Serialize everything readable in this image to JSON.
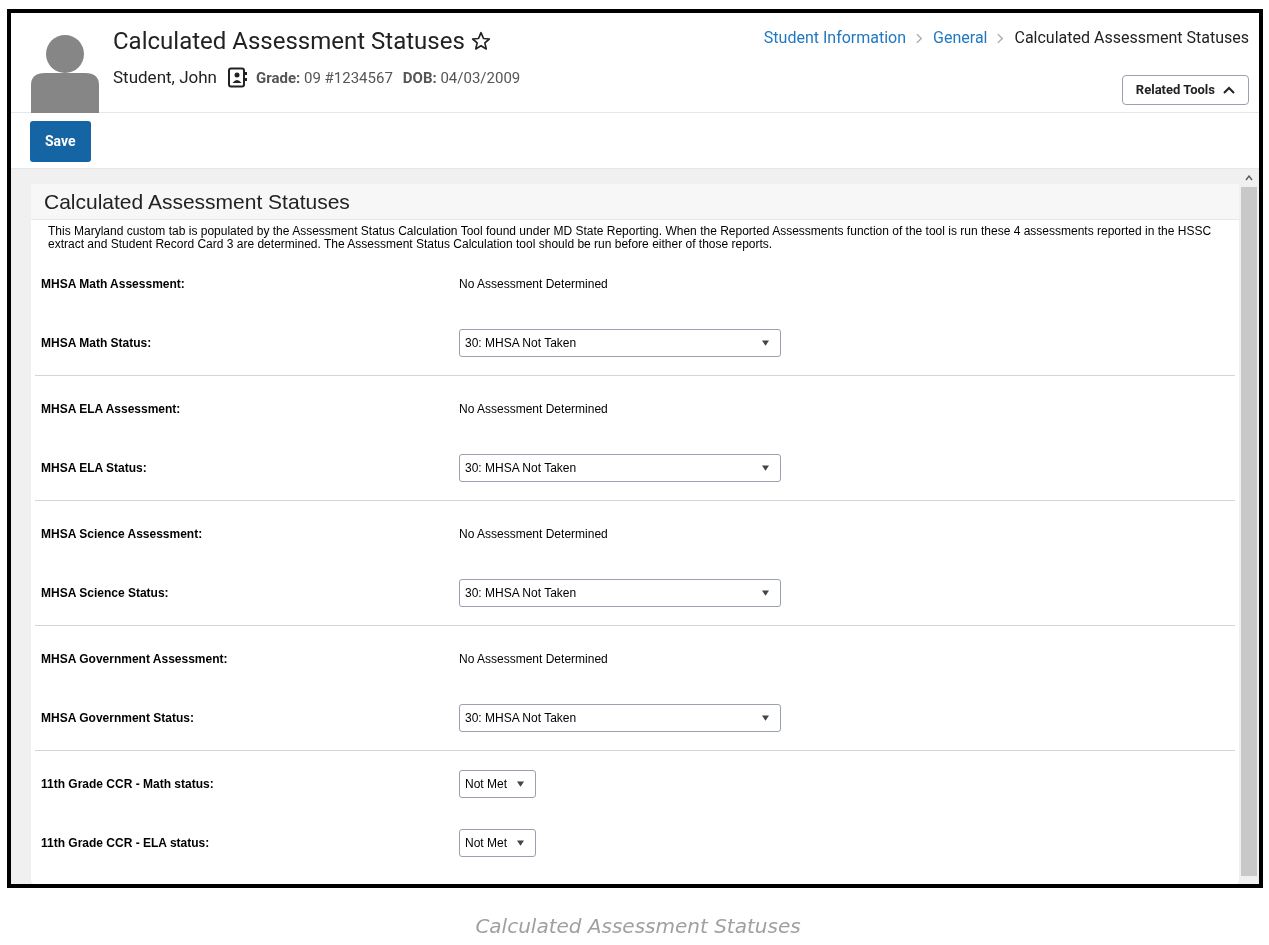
{
  "header": {
    "title": "Calculated Assessment Statuses",
    "favorite": false,
    "student_name": "Student, John",
    "grade_label": "Grade:",
    "grade_value": "09 #1234567",
    "dob_label": "DOB:",
    "dob_value": "04/03/2009",
    "breadcrumbs": [
      {
        "label": "Student Information",
        "link": true
      },
      {
        "label": "General",
        "link": true
      },
      {
        "label": "Calculated Assessment Statuses",
        "link": false
      }
    ],
    "related_tools": {
      "label": "Related Tools",
      "expanded": true
    }
  },
  "toolbar": {
    "save": "Save"
  },
  "panel": {
    "title": "Calculated Assessment Statuses",
    "description": "This Maryland custom tab is populated by the Assessment Status Calculation Tool found under MD State Reporting. When the Reported Assessments function of the tool is run these 4 assessments reported in the HSSC extract and Student Record Card 3 are determined. The Assessment Status Calculation tool should be run before either of those reports.",
    "sections": [
      [
        {
          "kind": "text",
          "label": "MHSA Math Assessment:",
          "value": "No Assessment Determined"
        },
        {
          "kind": "select",
          "label": "MHSA Math Status:",
          "value": "30: MHSA Not Taken"
        }
      ],
      [
        {
          "kind": "text",
          "label": "MHSA ELA Assessment:",
          "value": "No Assessment Determined"
        },
        {
          "kind": "select",
          "label": "MHSA ELA Status:",
          "value": "30: MHSA Not Taken"
        }
      ],
      [
        {
          "kind": "text",
          "label": "MHSA Science Assessment:",
          "value": "No Assessment Determined"
        },
        {
          "kind": "select",
          "label": "MHSA Science Status:",
          "value": "30: MHSA Not Taken"
        }
      ],
      [
        {
          "kind": "text",
          "label": "MHSA Government Assessment:",
          "value": "No Assessment Determined"
        },
        {
          "kind": "select",
          "label": "MHSA Government Status:",
          "value": "30: MHSA Not Taken"
        }
      ],
      [
        {
          "kind": "small_select",
          "label": "11th Grade CCR - Math status:",
          "value": "Not Met"
        },
        {
          "kind": "small_select",
          "label": "11th Grade CCR - ELA status:",
          "value": "Not Met"
        }
      ]
    ]
  },
  "caption": "Calculated Assessment Statuses"
}
